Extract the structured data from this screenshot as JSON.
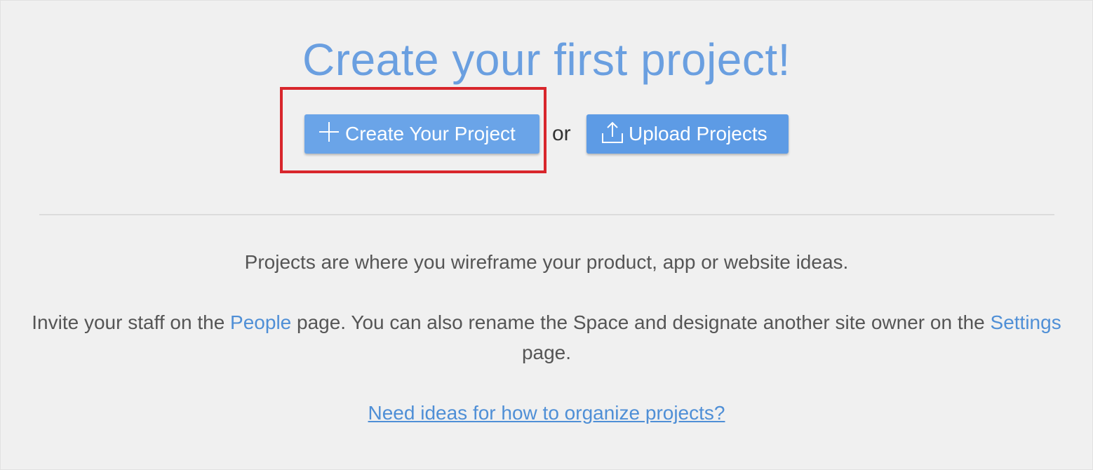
{
  "heading": "Create your first project!",
  "actions": {
    "create_label": "Create Your Project",
    "create_icon": "plus-icon",
    "or_label": "or",
    "upload_label": "Upload Projects",
    "upload_icon": "upload-icon"
  },
  "intro": "Projects are where you wireframe your product, app or website ideas.",
  "invite": {
    "before_people": "Invite your staff on the ",
    "people_link": "People",
    "between": " page. You can also rename the Space and designate another site owner on the ",
    "settings_link": "Settings",
    "after": " page."
  },
  "ideas_link": "Need ideas for how to organize projects?",
  "colors": {
    "title": "#6a9fe0",
    "button": "#5d9be5",
    "button_create": "#6aa4e8",
    "link": "#4f8fd6",
    "highlight": "#d8262c",
    "background": "#f0f0f0",
    "body_text": "#555555"
  }
}
